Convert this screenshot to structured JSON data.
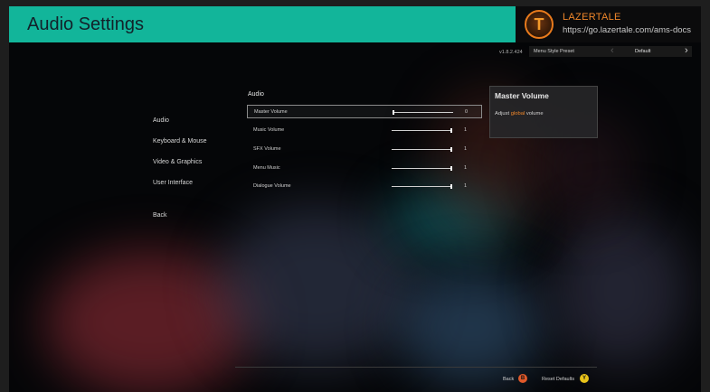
{
  "header": {
    "title": "Audio Settings"
  },
  "brand": {
    "logo_letter": "T",
    "name": "LAZERTALE",
    "url": "https://go.lazertale.com/ams-docs"
  },
  "version": "v1.8.2.424",
  "preset": {
    "label": "Menu Style Preset",
    "value": "Default",
    "left_icon": "chevron-left-icon",
    "right_icon": "chevron-right-icon"
  },
  "nav": {
    "items": [
      "Audio",
      "Keyboard & Mouse",
      "Video & Graphics",
      "User Interface"
    ],
    "back": "Back"
  },
  "section": {
    "title": "Audio"
  },
  "sliders": [
    {
      "label": "Master Volume",
      "value": "0",
      "level": 0
    },
    {
      "label": "Music Volume",
      "value": "1",
      "level": 1
    },
    {
      "label": "SFX Volume",
      "value": "1",
      "level": 1
    },
    {
      "label": "Menu Music",
      "value": "1",
      "level": 1
    },
    {
      "label": "Dialogue Volume",
      "value": "1",
      "level": 1
    }
  ],
  "info": {
    "title": "Master Volume",
    "desc_prefix": "Adjust",
    "desc_highlight": "global",
    "desc_suffix": "volume"
  },
  "footer": {
    "back": {
      "label": "Back",
      "glyph": "B",
      "color": "#e0592a"
    },
    "reset": {
      "label": "Reset Defaults",
      "glyph": "Y",
      "color": "#e8c21a"
    }
  },
  "colors": {
    "accent": "#12b59a",
    "brand": "#f0872a"
  }
}
